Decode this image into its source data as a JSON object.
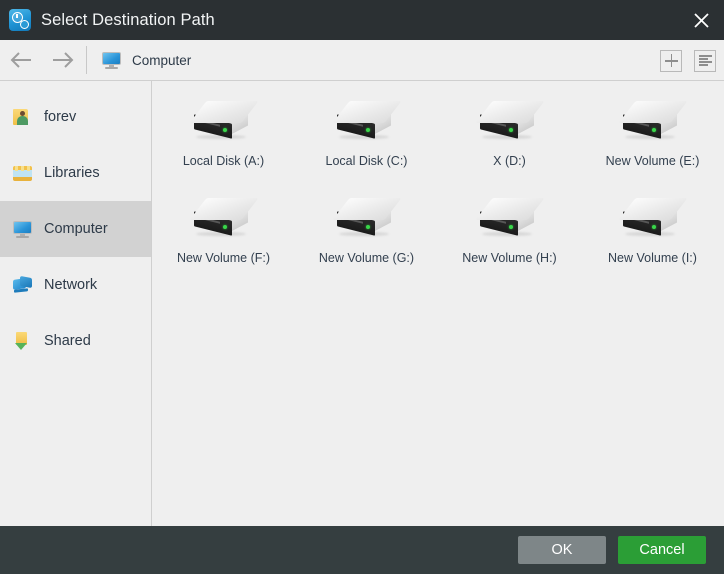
{
  "titlebar": {
    "title": "Select Destination Path",
    "app_icon": "clock-gear-icon",
    "close_icon": "close-icon"
  },
  "toolbar": {
    "back_icon": "arrow-left-icon",
    "forward_icon": "arrow-right-icon",
    "breadcrumb": {
      "icon": "computer-monitor-icon",
      "label": "Computer"
    },
    "new_folder_icon": "plus-icon",
    "view_list_icon": "list-view-icon"
  },
  "sidebar": {
    "items": [
      {
        "label": "forev",
        "icon": "user-folder-icon",
        "selected": false
      },
      {
        "label": "Libraries",
        "icon": "libraries-folder-icon",
        "selected": false
      },
      {
        "label": "Computer",
        "icon": "computer-monitor-icon",
        "selected": true
      },
      {
        "label": "Network",
        "icon": "network-icon",
        "selected": false
      },
      {
        "label": "Shared",
        "icon": "shared-folder-icon",
        "selected": false
      }
    ]
  },
  "filearea": {
    "drives": [
      {
        "label": "Local Disk (A:)",
        "icon": "hard-drive-icon"
      },
      {
        "label": "Local Disk (C:)",
        "icon": "hard-drive-icon"
      },
      {
        "label": "X (D:)",
        "icon": "hard-drive-icon"
      },
      {
        "label": "New Volume (E:)",
        "icon": "hard-drive-icon"
      },
      {
        "label": "New Volume (F:)",
        "icon": "hard-drive-icon"
      },
      {
        "label": "New Volume (G:)",
        "icon": "hard-drive-icon"
      },
      {
        "label": "New Volume (H:)",
        "icon": "hard-drive-icon"
      },
      {
        "label": "New Volume (I:)",
        "icon": "hard-drive-icon"
      }
    ]
  },
  "footer": {
    "ok_label": "OK",
    "cancel_label": "Cancel"
  },
  "colors": {
    "titlebar_bg": "#2b3033",
    "footer_bg": "#353e40",
    "accent_green": "#2b9e36",
    "ok_gray": "#7e8688",
    "selection_gray": "#d2d2d2",
    "panel_bg": "#efefef",
    "drive_led_green": "#39d64a"
  }
}
